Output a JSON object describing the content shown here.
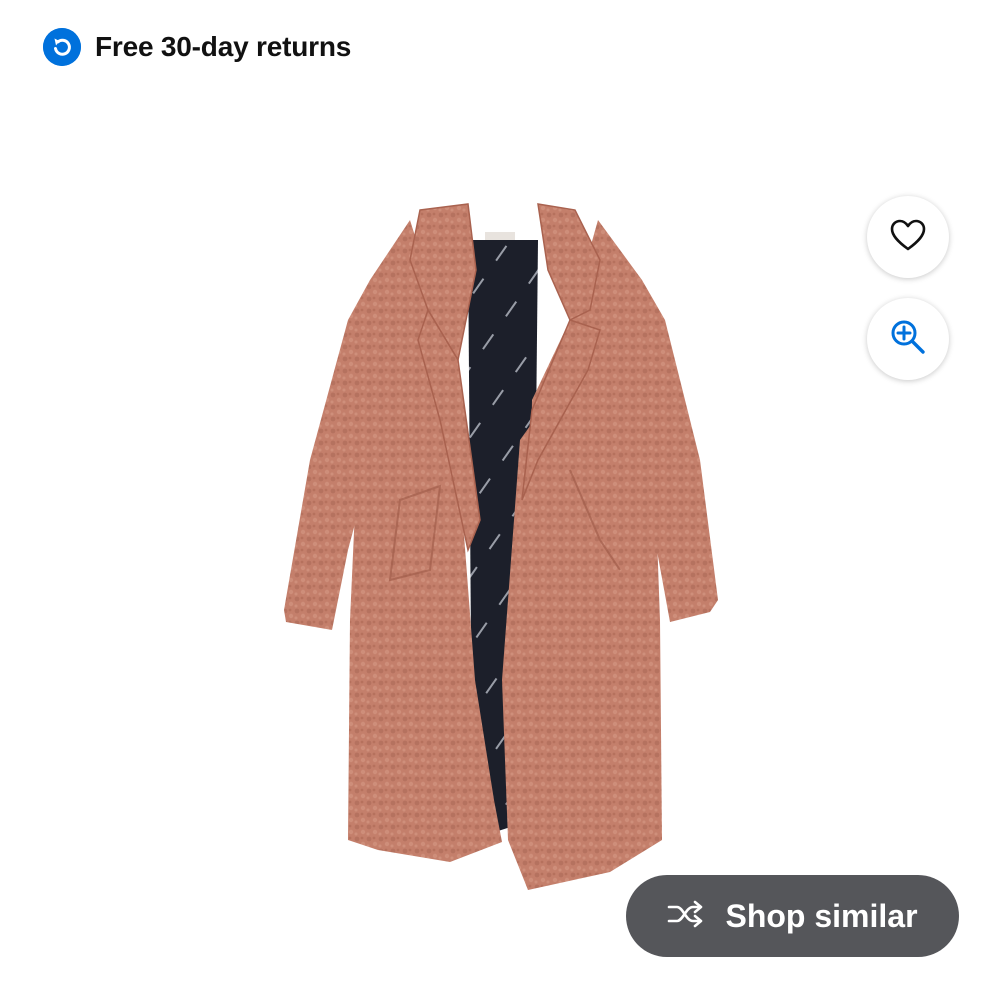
{
  "banner": {
    "text": "Free 30-day returns",
    "icon": "return-arrow-icon"
  },
  "product": {
    "image_icon": "coat-image"
  },
  "actions": {
    "favorite_icon": "heart-icon",
    "zoom_icon": "zoom-in-icon"
  },
  "shop_similar": {
    "label": "Shop similar",
    "icon": "shuffle-icon"
  },
  "colors": {
    "accent": "#0071dc",
    "pill": "#55565a",
    "coat": "#c47f6b",
    "lining": "#1c1f2a"
  }
}
